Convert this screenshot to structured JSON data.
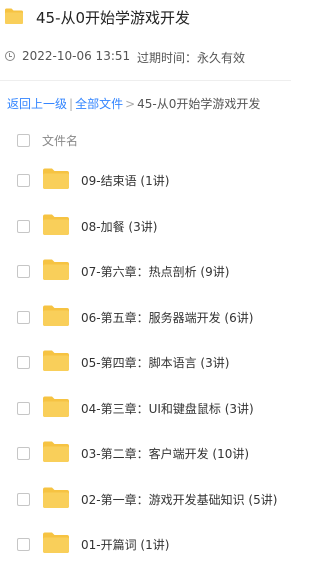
{
  "header": {
    "title": "45-从0开始学游戏开发"
  },
  "meta": {
    "timestamp": "2022-10-06 13:51",
    "expire_label": "过期时间：永久有效"
  },
  "breadcrumb": {
    "back": "返回上一级",
    "divider": "|",
    "all_files": "全部文件",
    "arrow": ">",
    "current": "45-从0开始学游戏开发"
  },
  "columns": {
    "filename": "文件名"
  },
  "files": [
    {
      "name": "09-结束语 (1讲)"
    },
    {
      "name": "08-加餐 (3讲)"
    },
    {
      "name": "07-第六章：热点剖析 (9讲)"
    },
    {
      "name": "06-第五章：服务器端开发 (6讲)"
    },
    {
      "name": "05-第四章：脚本语言 (3讲)"
    },
    {
      "name": "04-第三章：UI和键盘鼠标 (3讲)"
    },
    {
      "name": "03-第二章：客户端开发 (10讲)"
    },
    {
      "name": "02-第一章：游戏开发基础知识 (5讲)"
    },
    {
      "name": "01-开篇词 (1讲)"
    }
  ],
  "colors": {
    "folder": "#f6c342",
    "link": "#3385ff"
  }
}
